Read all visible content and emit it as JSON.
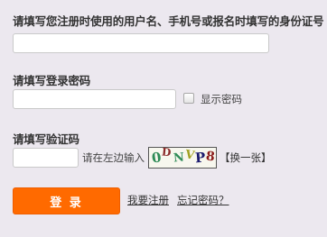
{
  "account": {
    "label": "请填写您注册时使用的用户名、手机号或报名时填写的身份证号",
    "value": "",
    "placeholder": ""
  },
  "password": {
    "label": "请填写登录密码",
    "value": "",
    "placeholder": "",
    "show_password_label": "显示密码",
    "show_password_checked": false
  },
  "captcha": {
    "label": "请填写验证码",
    "value": "",
    "placeholder": "",
    "hint": "请在左边输入",
    "image_chars": [
      "0",
      "D",
      "N",
      "V",
      "P",
      "8"
    ],
    "image_colors": [
      "#2e8b57",
      "#8b2a2a",
      "#2e8b57",
      "#a0a020",
      "#1a1a6e",
      "#8b1a1a"
    ],
    "refresh_label": "【换一张】"
  },
  "actions": {
    "login_label": "登 录",
    "register_label": "我要注册",
    "forgot_label": "忘记密码？"
  },
  "colors": {
    "accent": "#ff6a00",
    "background": "#ece8ef"
  }
}
